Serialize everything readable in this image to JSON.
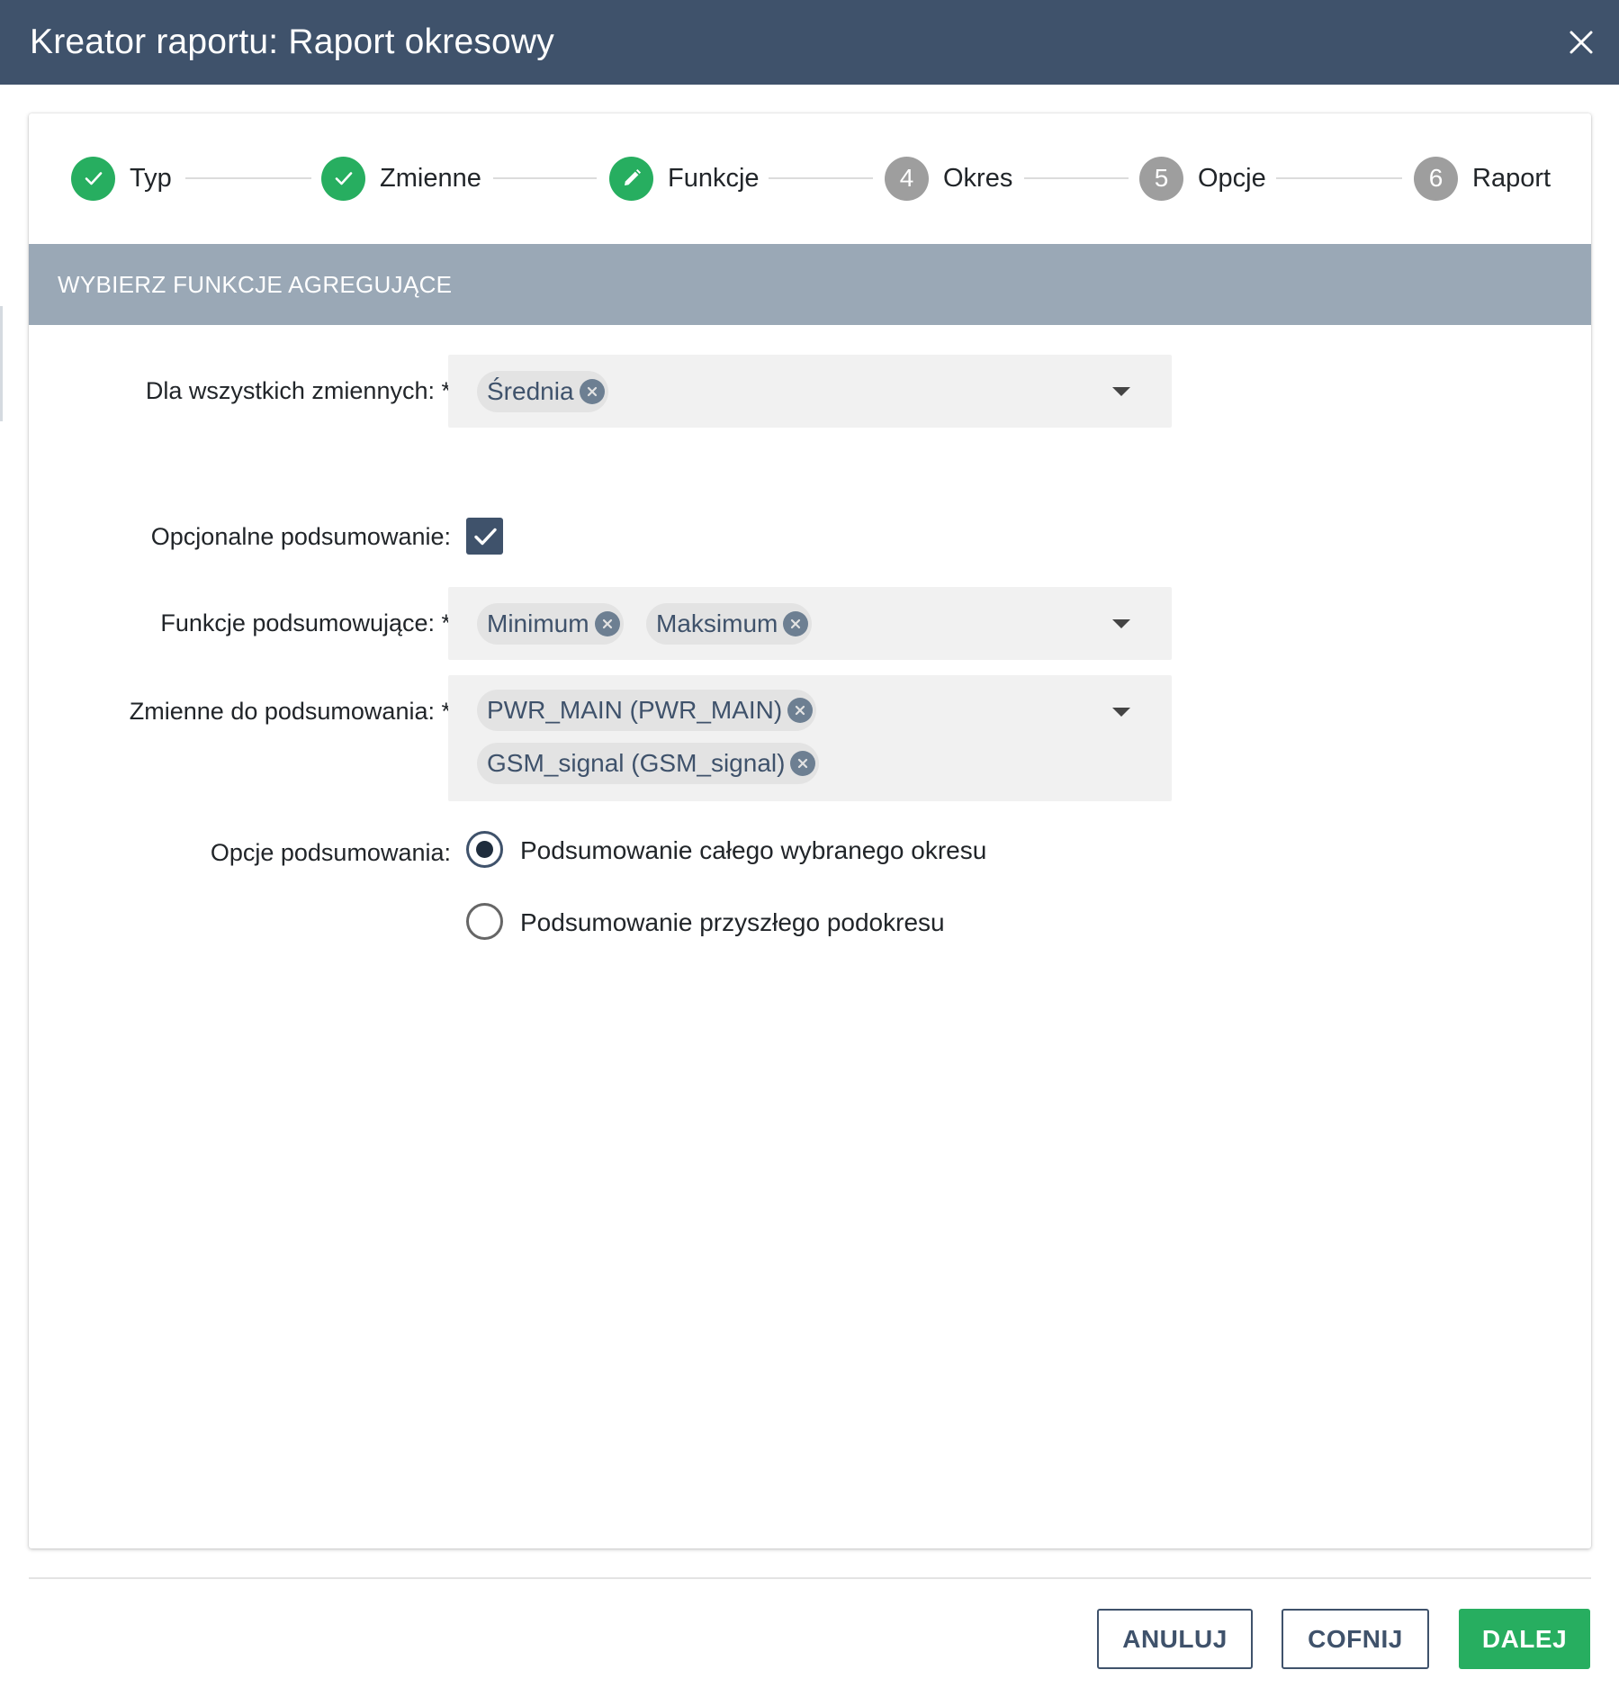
{
  "dialog": {
    "title": "Kreator raportu: Raport okresowy"
  },
  "colors": {
    "header_bg": "#3f526b",
    "section_bg": "#9aa8b6",
    "success": "#27ae60",
    "step_todo": "#9e9e9e",
    "chip_bg": "#e3e3e3",
    "chip_text": "#3f526b"
  },
  "stepper": {
    "steps": [
      {
        "label": "Typ",
        "state": "done",
        "icon": "check-icon"
      },
      {
        "label": "Zmienne",
        "state": "done",
        "icon": "check-icon"
      },
      {
        "label": "Funkcje",
        "state": "active",
        "icon": "pencil-icon"
      },
      {
        "label": "Okres",
        "state": "todo",
        "number": "4"
      },
      {
        "label": "Opcje",
        "state": "todo",
        "number": "5"
      },
      {
        "label": "Raport",
        "state": "todo",
        "number": "6"
      }
    ]
  },
  "section": {
    "title": "WYBIERZ FUNKCJE AGREGUJĄCE"
  },
  "form": {
    "all_vars_label": "Dla wszystkich zmiennych: *",
    "all_vars_chips": [
      "Średnia"
    ],
    "optional_summary_label": "Opcjonalne podsumowanie:",
    "optional_summary_checked": true,
    "summary_functions_label": "Funkcje podsumowujące: *",
    "summary_functions_chips": [
      "Minimum",
      "Maksimum"
    ],
    "summary_vars_label": "Zmienne do podsumowania: *",
    "summary_vars_chips": [
      "PWR_MAIN (PWR_MAIN)",
      "GSM_signal (GSM_signal)"
    ],
    "summary_options_label": "Opcje podsumowania:",
    "summary_options": [
      {
        "label": "Podsumowanie całego wybranego okresu",
        "selected": true
      },
      {
        "label": "Podsumowanie przyszłego podokresu",
        "selected": false
      }
    ]
  },
  "footer": {
    "cancel_label": "ANULUJ",
    "back_label": "COFNIJ",
    "next_label": "DALEJ"
  }
}
